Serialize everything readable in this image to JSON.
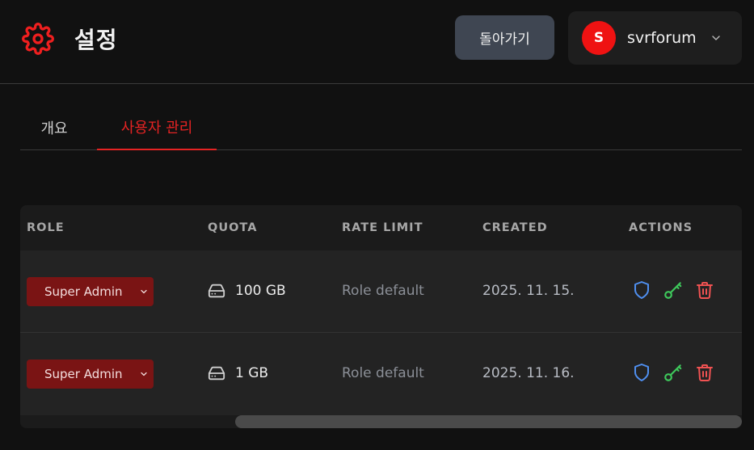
{
  "header": {
    "title": "설정",
    "back_label": "돌아가기",
    "user": {
      "initial": "S",
      "name": "svrforum"
    }
  },
  "tabs": [
    {
      "label": "개요",
      "active": false
    },
    {
      "label": "사용자 관리",
      "active": true
    }
  ],
  "table": {
    "columns": [
      "ROLE",
      "QUOTA",
      "RATE LIMIT",
      "CREATED",
      "ACTIONS"
    ],
    "rows": [
      {
        "role": "Super Admin",
        "quota": "100 GB",
        "rate_limit": "Role default",
        "created": "2025. 11. 15."
      },
      {
        "role": "Super Admin",
        "quota": "1 GB",
        "rate_limit": "Role default",
        "created": "2025. 11. 16."
      }
    ]
  },
  "colors": {
    "accent": "#e52323",
    "shield": "#4f8ff0",
    "key": "#3ec85b",
    "trash": "#f05252",
    "role_badge": "#7a1414"
  },
  "icons": [
    "gear-icon",
    "chevron-down-icon",
    "hard-drive-icon",
    "shield-icon",
    "key-icon",
    "trash-icon"
  ]
}
